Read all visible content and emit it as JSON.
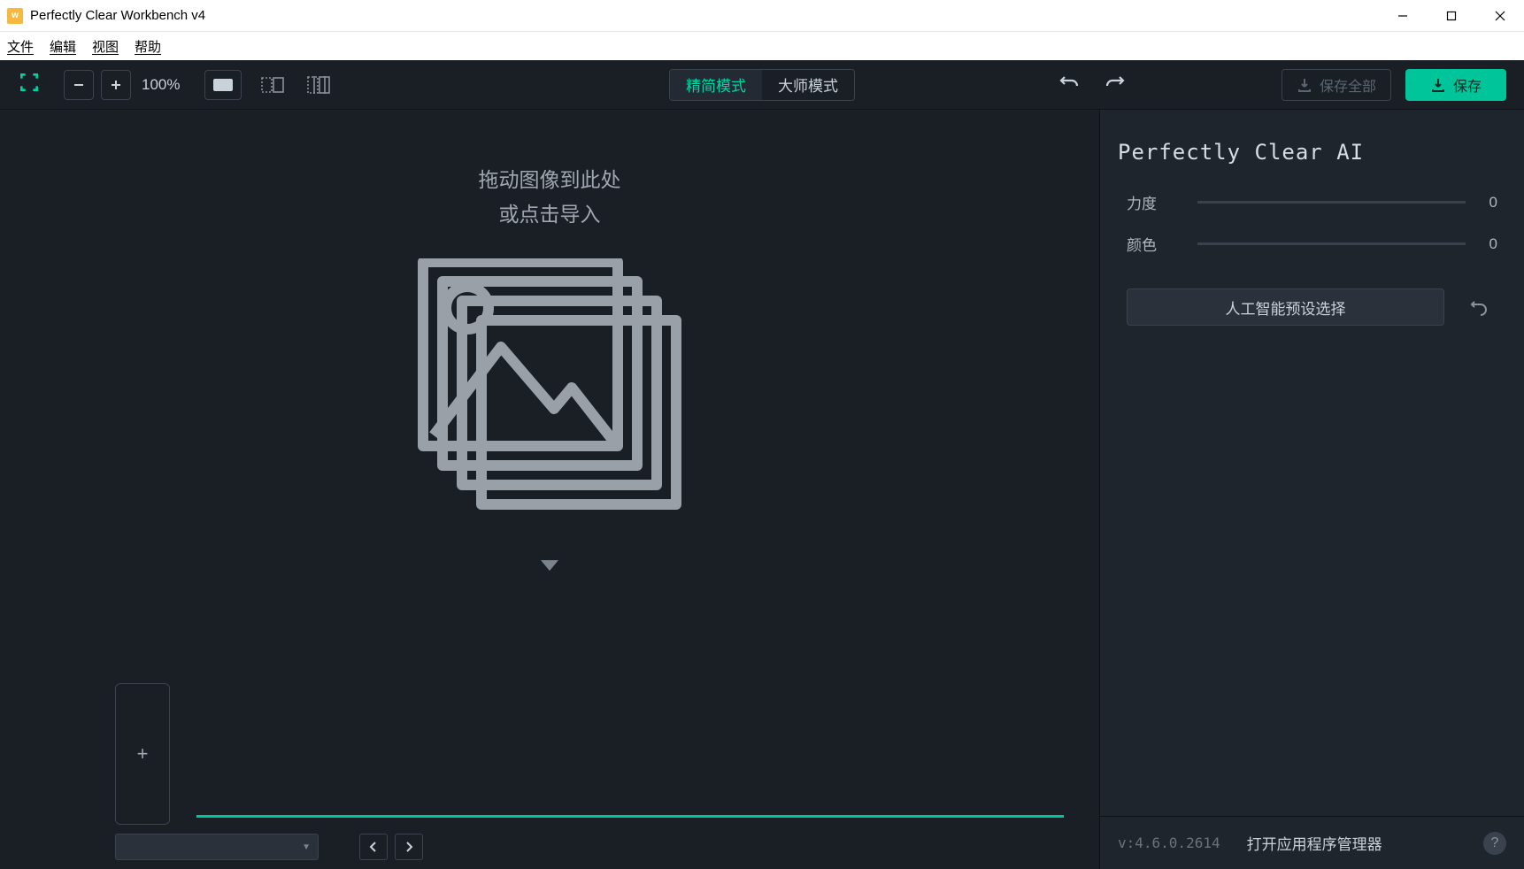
{
  "window": {
    "title": "Perfectly Clear Workbench v4"
  },
  "menu": {
    "file": "文件",
    "edit": "编辑",
    "view": "视图",
    "help": "帮助"
  },
  "toolbar": {
    "zoom": "100%",
    "mode_simple": "精简模式",
    "mode_master": "大师模式",
    "save_all": "保存全部",
    "save": "保存"
  },
  "drop": {
    "line1": "拖动图像到此处",
    "line2": "或点击导入"
  },
  "panel": {
    "title": "Perfectly Clear AI",
    "strength_label": "力度",
    "strength_value": "0",
    "color_label": "颜色",
    "color_value": "0",
    "preset_button": "人工智能预设选择"
  },
  "footer": {
    "version": "v:4.6.0.2614",
    "manager": "打开应用程序管理器",
    "help": "?"
  }
}
